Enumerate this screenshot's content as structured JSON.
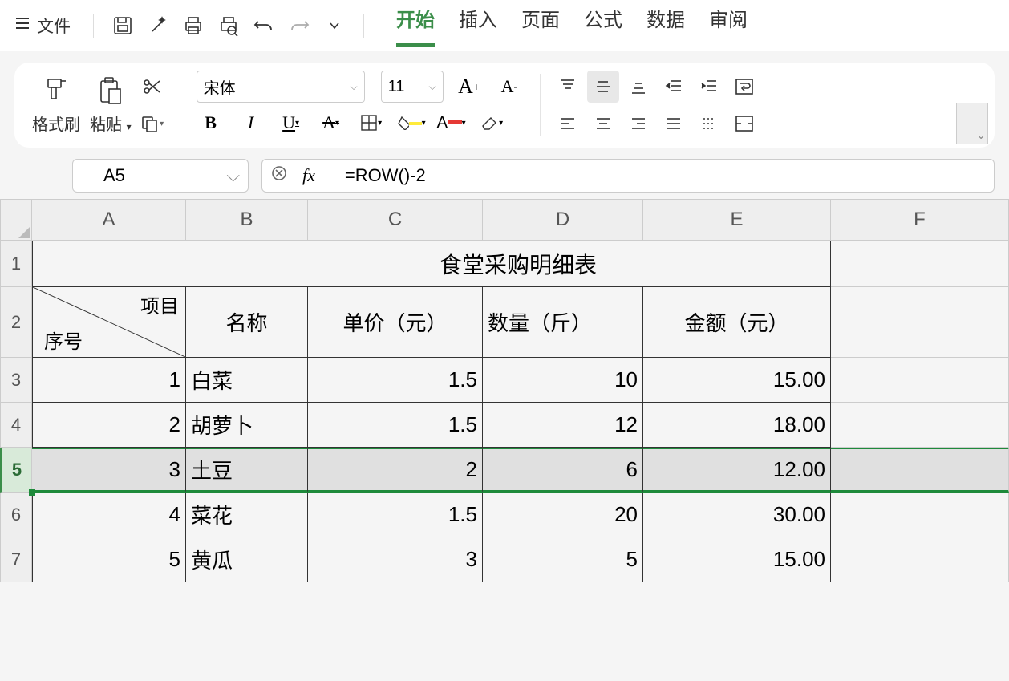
{
  "menu": {
    "file": "文件"
  },
  "tabs": {
    "start": "开始",
    "insert": "插入",
    "page": "页面",
    "formula": "公式",
    "data": "数据",
    "review": "审阅"
  },
  "ribbon": {
    "format_painter": "格式刷",
    "paste": "粘贴",
    "font_name": "宋体",
    "font_size": "11"
  },
  "formula_bar": {
    "name": "A5",
    "fx_label": "fx",
    "formula": "=ROW()-2"
  },
  "columns": [
    "A",
    "B",
    "C",
    "D",
    "E",
    "F"
  ],
  "rows": [
    "1",
    "2",
    "3",
    "4",
    "5",
    "6",
    "7"
  ],
  "sheet": {
    "title": "食堂采购明细表",
    "diag_top": "项目",
    "diag_bottom": "序号",
    "headers": {
      "B": "名称",
      "C": "单价（元）",
      "D": "数量（斤）",
      "E": "金额（元）"
    },
    "data": [
      {
        "A": "1",
        "B": "白菜",
        "C": "1.5",
        "D": "10",
        "E": "15.00"
      },
      {
        "A": "2",
        "B": "胡萝卜",
        "C": "1.5",
        "D": "12",
        "E": "18.00"
      },
      {
        "A": "3",
        "B": "土豆",
        "C": "2",
        "D": "6",
        "E": "12.00"
      },
      {
        "A": "4",
        "B": "菜花",
        "C": "1.5",
        "D": "20",
        "E": "30.00"
      },
      {
        "A": "5",
        "B": "黄瓜",
        "C": "3",
        "D": "5",
        "E": "15.00"
      }
    ]
  }
}
